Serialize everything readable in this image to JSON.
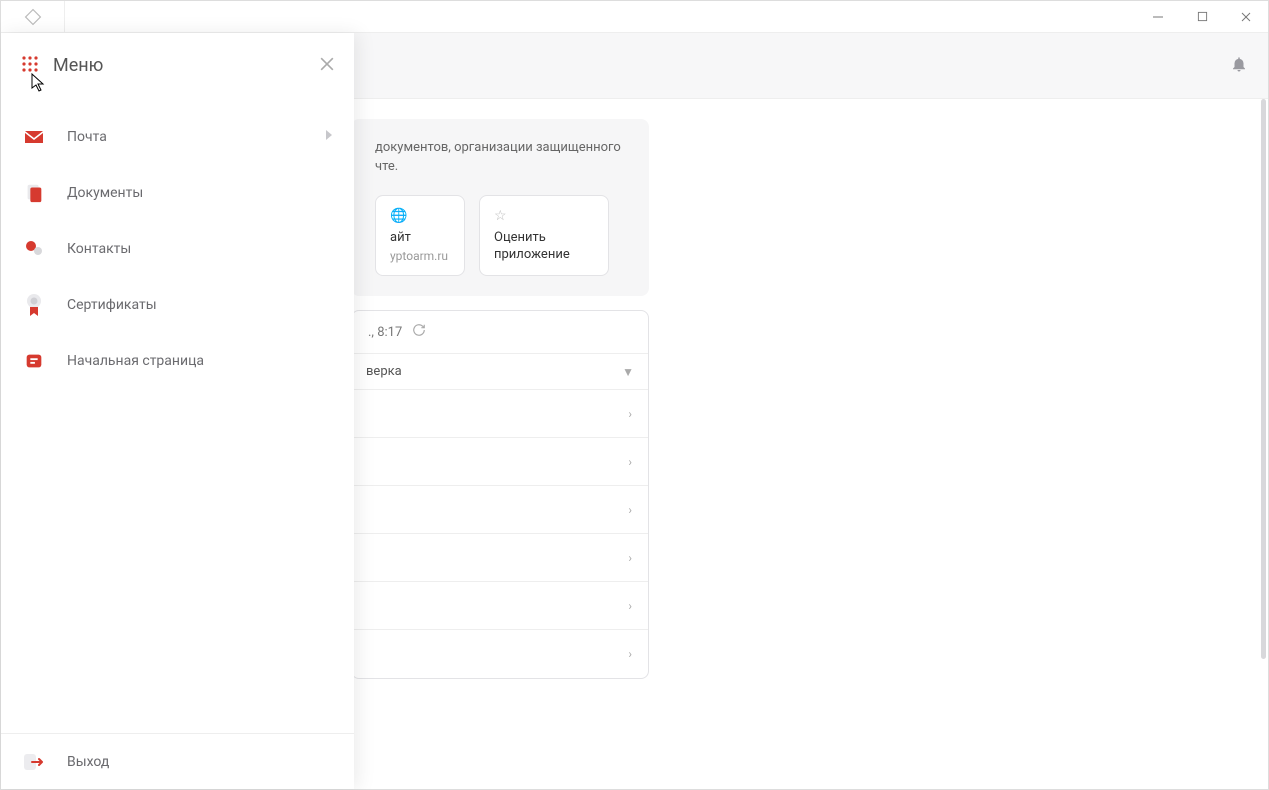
{
  "titlebar": {
    "app_icon": "app-logo"
  },
  "header": {
    "bell": "notifications"
  },
  "drawer": {
    "title": "Меню",
    "items": [
      {
        "label": "Почта",
        "icon": "mail-icon",
        "has_sub": true
      },
      {
        "label": "Документы",
        "icon": "documents-icon",
        "has_sub": false
      },
      {
        "label": "Контакты",
        "icon": "contacts-icon",
        "has_sub": false
      },
      {
        "label": "Сертификаты",
        "icon": "certificate-icon",
        "has_sub": false
      },
      {
        "label": "Начальная страница",
        "icon": "home-icon",
        "has_sub": false
      }
    ],
    "exit_label": "Выход"
  },
  "main": {
    "info_text": "документов, организации защищенного чте.",
    "tiles": [
      {
        "label": "айт",
        "sub": "yptoarm.ru"
      },
      {
        "label": "Оценить приложение",
        "sub": ""
      }
    ],
    "card2_head": "., 8:17",
    "select_value": "верка",
    "rows_count": 6
  }
}
